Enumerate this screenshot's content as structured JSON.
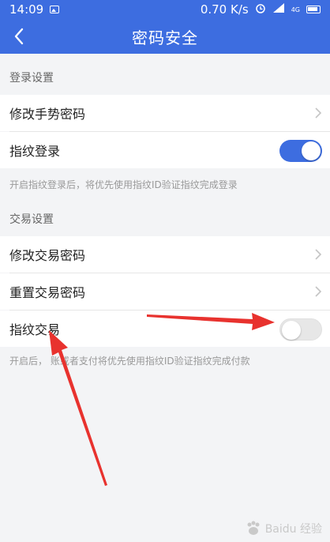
{
  "status_bar": {
    "time": "14:09",
    "speed": "0.70 K/s",
    "network": "4G"
  },
  "header": {
    "title": "密码安全"
  },
  "sections": [
    {
      "header": "登录设置",
      "rows": [
        {
          "label": "修改手势密码"
        },
        {
          "label": "指纹登录",
          "toggle_on": true
        }
      ],
      "note": "开启指纹登录后，将优先使用指纹ID验证指纹完成登录"
    },
    {
      "header": "交易设置",
      "rows": [
        {
          "label": "修改交易密码"
        },
        {
          "label": "重置交易密码"
        },
        {
          "label": "指纹交易",
          "toggle_on": false
        }
      ],
      "note": "开启后，    账或者支付将优先使用指纹ID验证指纹完成付款"
    }
  ],
  "watermark": "Baidu 经验",
  "colors": {
    "brand": "#3d6de0",
    "arrow": "#e8322e"
  }
}
